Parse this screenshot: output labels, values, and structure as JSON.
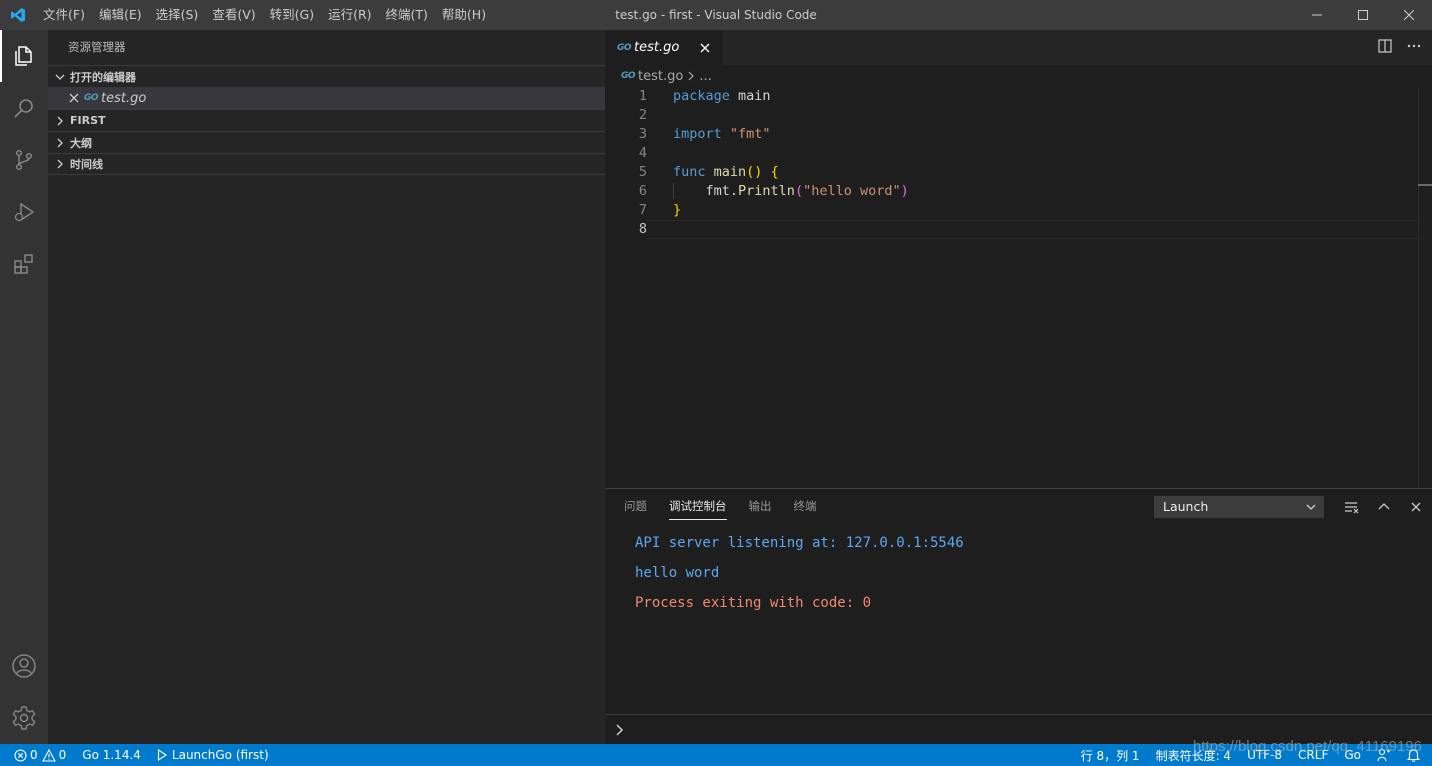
{
  "titlebar": {
    "menu": [
      "文件(F)",
      "编辑(E)",
      "选择(S)",
      "查看(V)",
      "转到(G)",
      "运行(R)",
      "终端(T)",
      "帮助(H)"
    ],
    "title": "test.go - first - Visual Studio Code"
  },
  "activitybar": {
    "items": [
      "explorer-icon",
      "search-icon",
      "source-control-icon",
      "run-debug-icon",
      "extensions-icon"
    ],
    "bottom": [
      "account-icon",
      "settings-gear-icon"
    ]
  },
  "sidebar": {
    "title": "资源管理器",
    "open_editors_header": "打开的编辑器",
    "open_editor": {
      "badge": "GO",
      "file": "test.go"
    },
    "sections": [
      "FIRST",
      "大纲",
      "时间线"
    ]
  },
  "editor": {
    "tab": {
      "badge": "GO",
      "file": "test.go"
    },
    "breadcrumb": {
      "badge": "GO",
      "file": "test.go",
      "more": "..."
    },
    "line_numbers": [
      "1",
      "2",
      "3",
      "4",
      "5",
      "6",
      "7",
      "8"
    ],
    "code": {
      "l1_kw": "package",
      "l1_id": " main",
      "l3_kw": "import",
      "l3_str": " \"fmt\"",
      "l5_kw": "func",
      "l5_fn": " main",
      "l5_br": "()",
      "l5_id": " ",
      "l5_br2": "{",
      "l6_indent": "    ",
      "l6_id": "fmt.",
      "l6_fn": "Println",
      "l6_br": "(",
      "l6_str": "\"hello word\"",
      "l6_br2": ")",
      "l7_br": "}"
    },
    "current_line": 8
  },
  "panel": {
    "tabs": [
      "问题",
      "调试控制台",
      "输出",
      "终端"
    ],
    "active_tab": "调试控制台",
    "launch_config": "Launch",
    "output": [
      {
        "text": "API server listening at: 127.0.0.1:5546",
        "color": "#5ba8f0"
      },
      {
        "text": "hello word",
        "color": "#5ba8f0"
      },
      {
        "text": "Process exiting with code: 0",
        "color": "#f48771"
      }
    ]
  },
  "statusbar": {
    "errors": "0",
    "warnings": "0",
    "go_version": "Go 1.14.4",
    "launch": "LaunchGo (first)",
    "position": "行 8，列 1",
    "indent": "制表符长度: 4",
    "encoding": "UTF-8",
    "eol": "CRLF",
    "language": "Go"
  },
  "watermark": "https://blog.csdn.net/qq_41169196",
  "colors": {
    "accent": "#007acc",
    "activity_bar": "#333333",
    "sidebar": "#252526",
    "editor": "#1e1e1e"
  }
}
